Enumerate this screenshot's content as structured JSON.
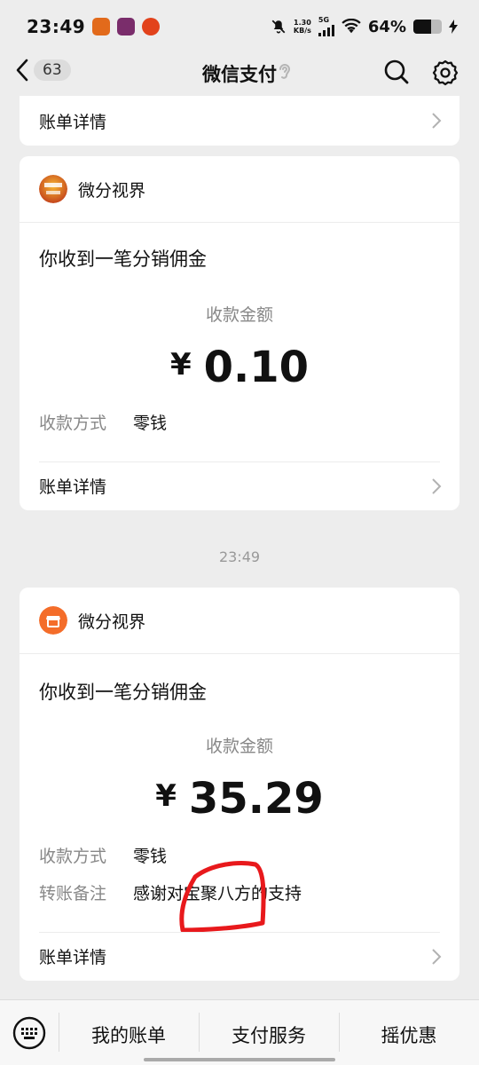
{
  "status_bar": {
    "time": "23:49",
    "net_speed_value": "1.30",
    "net_speed_unit": "KB/s",
    "network": "5G",
    "battery": "64%",
    "battery_level": 0.64
  },
  "header": {
    "unread_count": "63",
    "title": "微信支付"
  },
  "top_card": {
    "detail_label": "账单详情"
  },
  "messages": [
    {
      "merchant": "微分视界",
      "title": "你收到一笔分销佣金",
      "amount_label": "收款金额",
      "currency": "¥",
      "amount": "0.10",
      "method_label": "收款方式",
      "method_value": "零钱",
      "detail_label": "账单详情"
    },
    {
      "merchant": "微分视界",
      "title": "你收到一笔分销佣金",
      "amount_label": "收款金额",
      "currency": "¥",
      "amount": "35.29",
      "method_label": "收款方式",
      "method_value": "零钱",
      "remark_label": "转账备注",
      "remark_value": "感谢对宝聚八方的支持",
      "detail_label": "账单详情"
    }
  ],
  "timestamp": "23:49",
  "bottom_menu": {
    "items": [
      "我的账单",
      "支付服务",
      "摇优惠"
    ]
  },
  "colors": {
    "background": "#ededed",
    "card": "#ffffff",
    "brand_orange": "#f46d2a",
    "annotation_red": "#e8191c"
  },
  "icons": {
    "back": "chevron-left-icon",
    "ear": "ear-icon",
    "search": "search-icon",
    "settings": "gear-icon",
    "keyboard": "keyboard-icon",
    "chevron": "chevron-right-icon",
    "shop": "shop-icon"
  }
}
